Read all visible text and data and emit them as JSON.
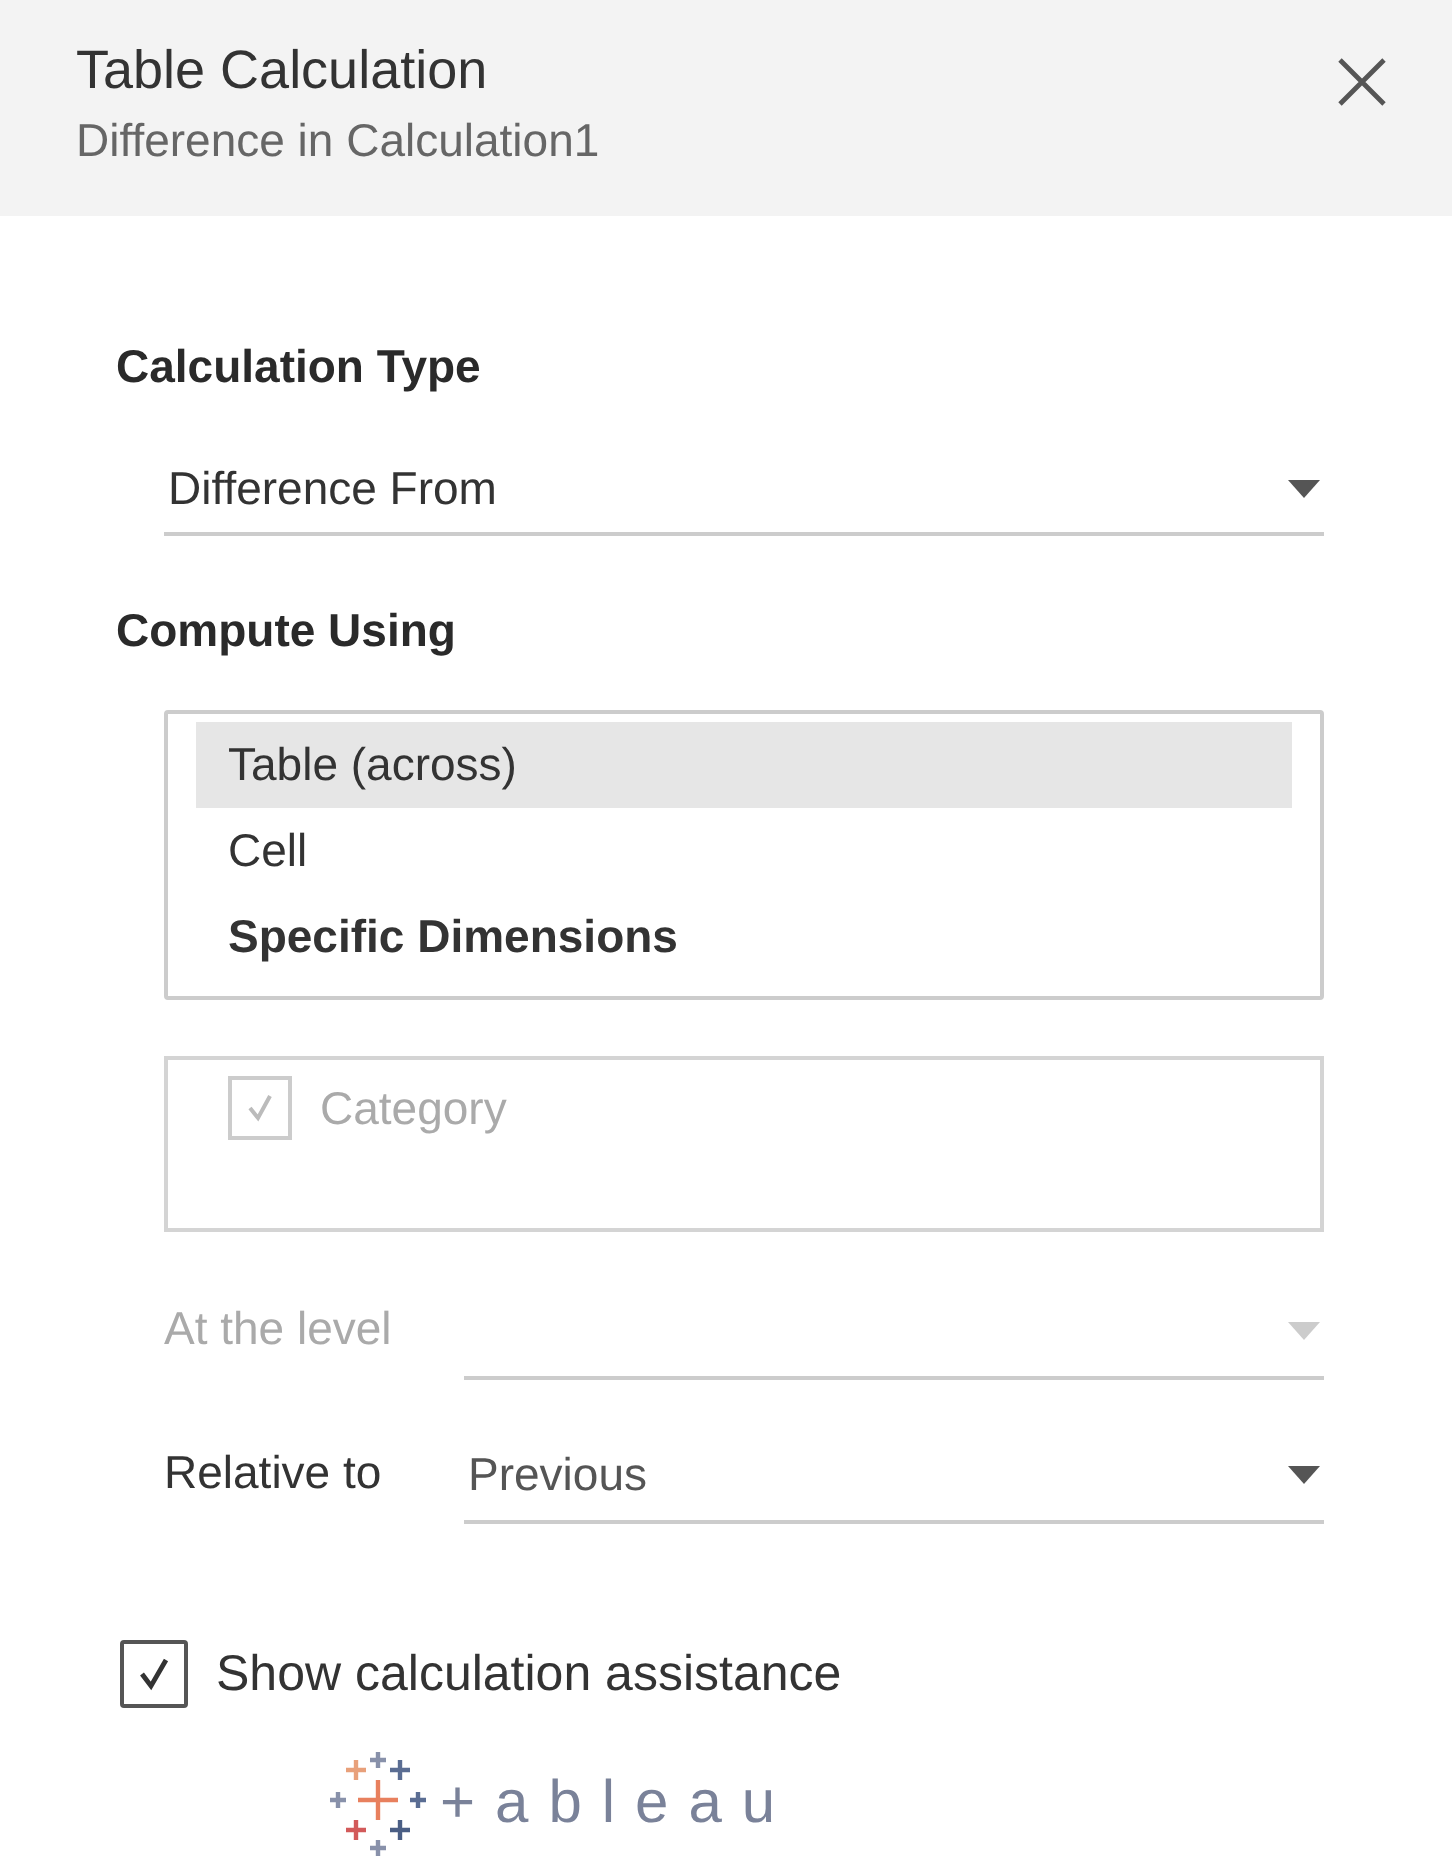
{
  "header": {
    "title": "Table Calculation",
    "subtitle": "Difference in Calculation1"
  },
  "calculation_type": {
    "label": "Calculation Type",
    "value": "Difference From"
  },
  "compute_using": {
    "label": "Compute Using",
    "options": [
      {
        "label": "Table (across)",
        "kind": "option",
        "selected": true
      },
      {
        "label": "Cell",
        "kind": "option",
        "selected": false
      },
      {
        "label": "Specific Dimensions",
        "kind": "heading",
        "selected": false
      }
    ]
  },
  "dimensions": {
    "disabled": true,
    "items": [
      {
        "label": "Category",
        "checked": true
      }
    ]
  },
  "fields": [
    {
      "label": "At the level",
      "disabled": true
    },
    {
      "label": "Relative to",
      "value": "Previous",
      "disabled": false
    }
  ],
  "assistance": {
    "label": "Show calculation assistance",
    "checked": true
  },
  "logo": {
    "wordmark": "+ableau"
  }
}
